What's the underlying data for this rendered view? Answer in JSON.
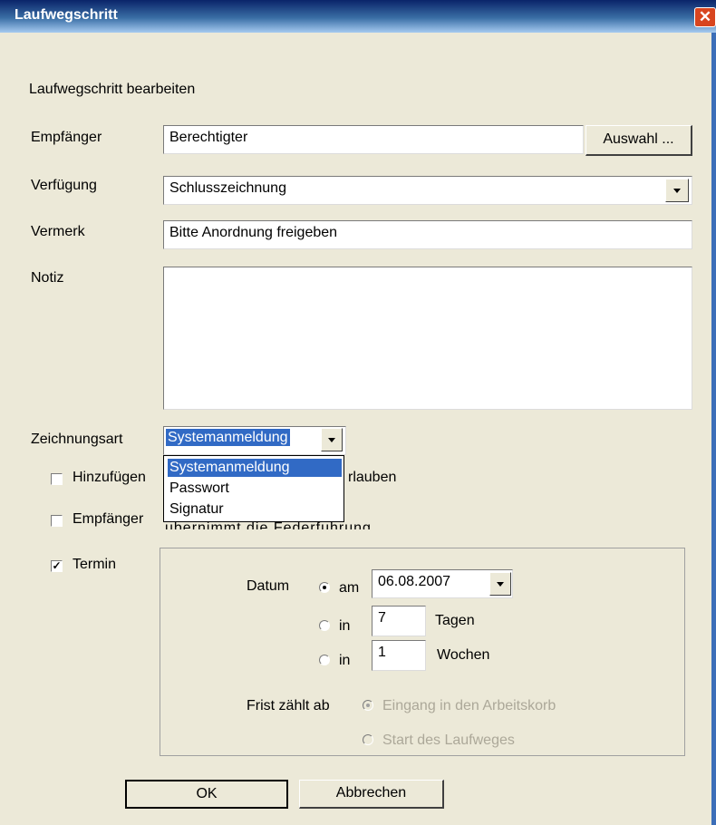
{
  "window": {
    "title": "Laufwegschritt",
    "close_glyph": "✕"
  },
  "heading": "Laufwegschritt bearbeiten",
  "empfaenger": {
    "label": "Empfänger",
    "value": "Berechtigter",
    "button": "Auswahl ..."
  },
  "verfuegung": {
    "label": "Verfügung",
    "value": "Schlusszeichnung"
  },
  "vermerk": {
    "label": "Vermerk",
    "value": "Bitte Anordnung freigeben"
  },
  "notiz": {
    "label": "Notiz",
    "value": ""
  },
  "zeichnungsart": {
    "label": "Zeichnungsart",
    "value": "Systemanmeldung",
    "options": [
      "Systemanmeldung",
      "Passwort",
      "Signatur"
    ],
    "highlighted_index": 0
  },
  "checkboxes": {
    "hinzufuegen": {
      "visible_label_left": "Hinzufügen",
      "visible_label_right": "rlauben",
      "checked": false
    },
    "uebernimmt": {
      "visible_label": "Empfänger",
      "checked": false
    },
    "termin": {
      "label": "Termin",
      "checked": true
    }
  },
  "termin": {
    "datum_label": "Datum",
    "am_label": "am",
    "date_value": "06.08.2007",
    "in_label": "in",
    "tage_value": "7",
    "tage_label": "Tagen",
    "wochen_value": "1",
    "wochen_label": "Wochen",
    "frist_label": "Frist zählt ab",
    "frist_options": [
      "Eingang in den Arbeitskorb",
      "Start des Laufweges"
    ]
  },
  "buttons": {
    "ok": "OK",
    "cancel": "Abbrechen"
  },
  "colors": {
    "title_bar": "#0a246a",
    "selection": "#316ac5",
    "dialog_bg": "#ece9d8",
    "close": "#d8451f"
  }
}
